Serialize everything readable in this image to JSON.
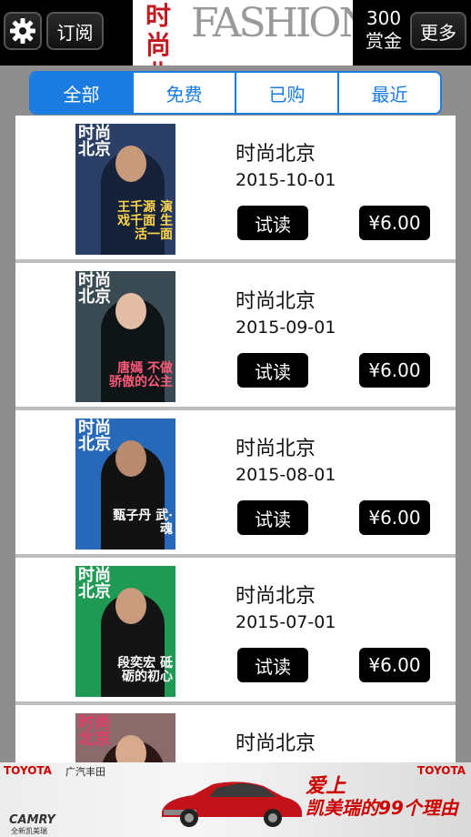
{
  "header": {
    "subscribe_label": "订阅",
    "logo_cn": "时尚北京",
    "logo_en": "FASHION",
    "coins_amount": "300",
    "coins_label": "赏金",
    "more_label": "更多",
    "settings_icon": "gear-icon"
  },
  "tabs": [
    {
      "label": "全部",
      "active": true
    },
    {
      "label": "免费",
      "active": false
    },
    {
      "label": "已购",
      "active": false
    },
    {
      "label": "最近",
      "active": false
    }
  ],
  "issues": [
    {
      "title": "时尚北京",
      "date": "2015-10-01",
      "try_label": "试读",
      "price": "¥6.00",
      "cover_headline": "王千源 演戏千面 生活一面",
      "cover_color": "#2b3f66"
    },
    {
      "title": "时尚北京",
      "date": "2015-09-01",
      "try_label": "试读",
      "price": "¥6.00",
      "cover_headline": "唐嫣 不做骄傲的公主",
      "cover_color": "#3a4a52"
    },
    {
      "title": "时尚北京",
      "date": "2015-08-01",
      "try_label": "试读",
      "price": "¥6.00",
      "cover_headline": "甄子丹 武·魂",
      "cover_color": "#2868b8"
    },
    {
      "title": "时尚北京",
      "date": "2015-07-01",
      "try_label": "试读",
      "price": "¥6.00",
      "cover_headline": "段奕宏 砥砺的初心",
      "cover_color": "#1f9a55"
    },
    {
      "title": "时尚北京",
      "date": "",
      "try_label": "",
      "price": "",
      "cover_headline": "",
      "cover_color": "#8a6a6a"
    }
  ],
  "ad": {
    "brand_left": "TOYOTA",
    "brand_left2": "广汽丰田",
    "brand_right": "TOYOTA",
    "model": "CAMRY",
    "model_sub": "全新凯美瑞",
    "slogan_line1": "爱上",
    "slogan_line2": "凯美瑞的99个理由"
  }
}
